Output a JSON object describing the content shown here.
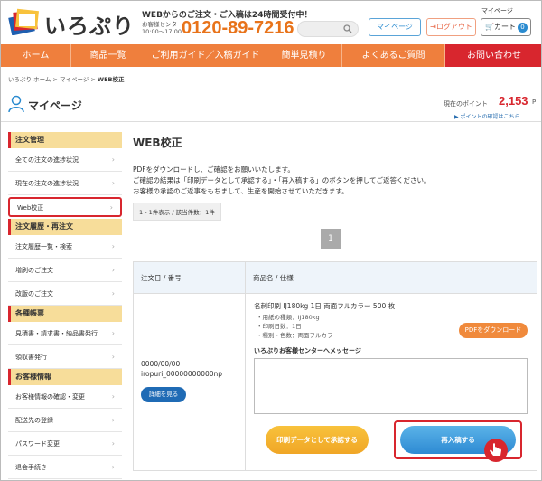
{
  "header": {
    "brand": "いろぷり",
    "tagline": "WEBからのご注文・ご入稿は24時間受付中！",
    "support_line1": "お客様センター",
    "support_line2": "10:00〜17:00",
    "phone": "0120-89-7216",
    "search_placeholder": "",
    "mypage_small": "マイページ",
    "mypage_button": "マイページ",
    "logout_button": "ログアウト",
    "cart_button": "カート",
    "cart_count": "0"
  },
  "nav": {
    "items": [
      {
        "label": "ホーム"
      },
      {
        "label": "商品一覧"
      },
      {
        "label": "ご利用ガイド／入稿ガイド"
      },
      {
        "label": "簡単見積り"
      },
      {
        "label": "よくあるご質問"
      },
      {
        "label": "お問い合わせ"
      }
    ]
  },
  "breadcrumb": {
    "path": "いろぷり ホーム > マイページ > ",
    "current": "WEB校正"
  },
  "page": {
    "title": "マイページ",
    "points_label": "現在のポイント",
    "points_value": "2,153",
    "points_unit": "P",
    "points_link": "▶ ポイントの確認はこちら"
  },
  "sidebar": {
    "sections": [
      {
        "heading": "注文管理",
        "items": [
          "全ての注文の進捗状況",
          "現在の注文の進捗状況",
          "Web校正"
        ]
      },
      {
        "heading": "注文履歴・再注文",
        "items": [
          "注文履歴一覧・検索",
          "増刷のご注文",
          "改版のご注文"
        ]
      },
      {
        "heading": "各種帳票",
        "items": [
          "見積書・請求書・納品書発行",
          "領収書発行"
        ]
      },
      {
        "heading": "お客様情報",
        "items": [
          "お客様情報の確認・変更",
          "配送先の登録",
          "パスワード変更",
          "退会手続き"
        ]
      }
    ]
  },
  "main": {
    "title": "WEB校正",
    "desc1": "PDFをダウンロードし、ご確認をお願いいたします。",
    "desc2": "ご確認の結果は「印刷データとして承認する」・「再入稿する」のボタンを押してご返答ください。",
    "desc3": "お客様の承認のご返事をもちまして、生産を開始させていただきます。",
    "count": "1 - 1件表示 / 該当件数：1件",
    "page_number": "1",
    "table": {
      "col1": "注文日 / 番号",
      "col2": "商品名 / 仕様",
      "order_date": "0000/00/00",
      "order_number": "iropuri_00000000000np",
      "detail_button": "詳細を見る",
      "product_name": "名刺印刷 IJ180kg 1日 両面フルカラー 500 枚",
      "spec1": "・用紙の種類：IJ180kg",
      "spec2": "・印刷日数：1日",
      "spec3": "・種別・色数：両面フルカラー",
      "pdf_button": "PDFをダウンロード",
      "message_label": "いろぷりお客様センターへメッセージ",
      "approve_button": "印刷データとして承認する",
      "reupload_button": "再入稿する"
    }
  },
  "colors": {
    "nav_orange": "#ef7f3d",
    "contact_red": "#d8262e",
    "phone_orange": "#e8731a",
    "link_blue": "#2a8bd0",
    "sidebar_head": "#f7dd9a"
  }
}
